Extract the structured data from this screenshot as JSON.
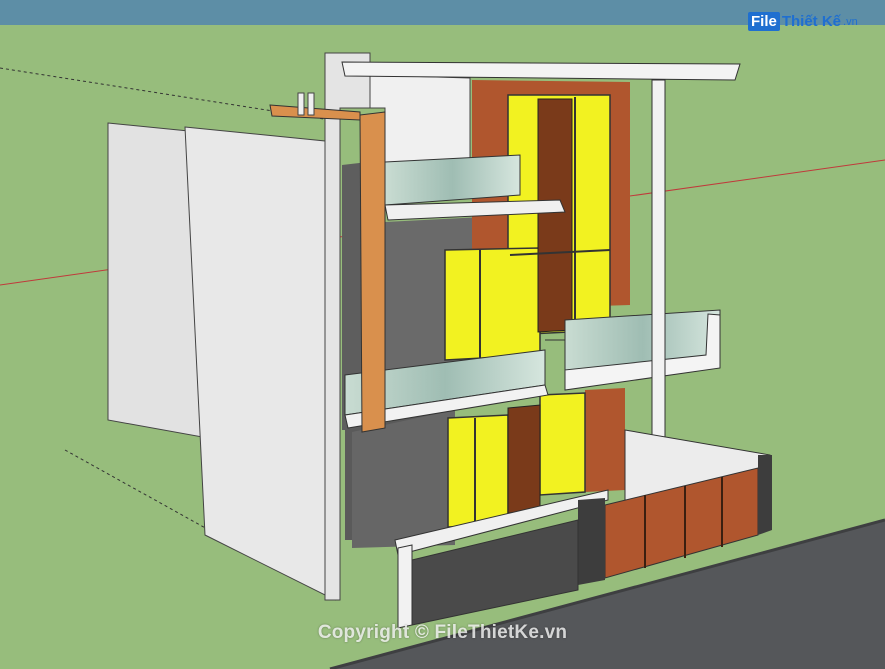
{
  "logo": {
    "box": "File",
    "text": "Thiết Kế",
    "tld": ".vn"
  },
  "watermark": "Copyright © FileThietKe.vn",
  "colors": {
    "sky": "#5d8ea6",
    "grass": "#97bd7c",
    "road": "#55575a",
    "wall": "#e7e7e7",
    "glass_yellow": "#f2f221",
    "brick": "#b0562e",
    "wood": "#7a3a1a",
    "timber_accent": "#d9904d",
    "slate": "#5e5e5e"
  }
}
